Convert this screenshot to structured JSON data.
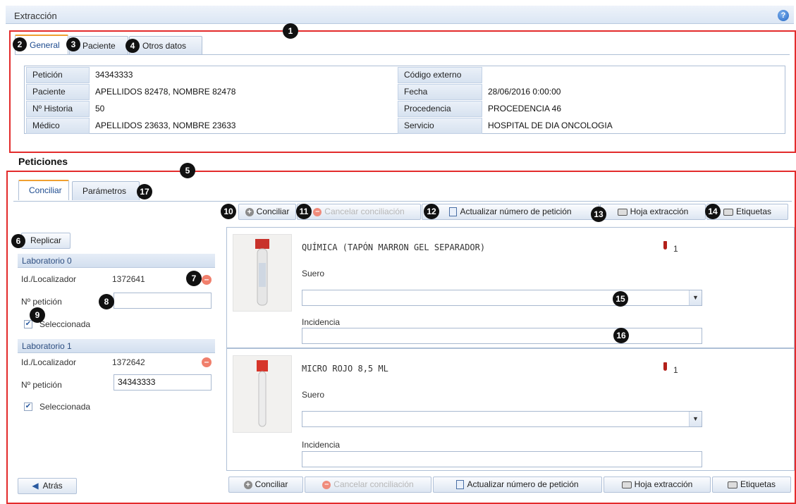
{
  "window": {
    "title": "Extracción",
    "help_icon": "?"
  },
  "badges": [
    "1",
    "2",
    "3",
    "4",
    "5",
    "6",
    "7",
    "8",
    "9",
    "10",
    "11",
    "12",
    "13",
    "14",
    "15",
    "16",
    "17"
  ],
  "colors": {
    "highlight": "#e32b2b",
    "accent": "#f0a030",
    "header_bg": "#dbe6f4"
  },
  "header_tabs": [
    {
      "label": "General",
      "active": true
    },
    {
      "label": "Paciente",
      "active": false
    },
    {
      "label": "Otros datos",
      "active": false
    }
  ],
  "general": {
    "left": [
      {
        "label": "Petición",
        "value": "34343333"
      },
      {
        "label": "Paciente",
        "value": "APELLIDOS 82478, NOMBRE 82478"
      },
      {
        "label": "Nº Historia",
        "value": "50"
      },
      {
        "label": "Médico",
        "value": "APELLIDOS 23633, NOMBRE 23633"
      }
    ],
    "right": [
      {
        "label": "Código externo",
        "value": ""
      },
      {
        "label": "Fecha",
        "value": "28/06/2016 0:00:00"
      },
      {
        "label": "Procedencia",
        "value": "PROCEDENCIA 46"
      },
      {
        "label": "Servicio",
        "value": "HOSPITAL DE DIA ONCOLOGIA"
      }
    ]
  },
  "peticiones": {
    "title": "Peticiones",
    "tabs": [
      {
        "label": "Conciliar",
        "active": true
      },
      {
        "label": "Parámetros",
        "active": false
      }
    ],
    "toolbar": {
      "conciliar": "Conciliar",
      "cancelar": "Cancelar conciliación",
      "actualizar": "Actualizar número de petición",
      "hoja": "Hoja extracción",
      "etiquetas": "Etiquetas"
    },
    "replicar": "Replicar",
    "atras": "Atrás",
    "labs": [
      {
        "header": "Laboratorio 0",
        "id_label": "Id./Localizador",
        "id_value": "1372641",
        "num_label": "Nº petición",
        "num_value": "",
        "selected_label": "Seleccionada",
        "selected": true
      },
      {
        "header": "Laboratorio 1",
        "id_label": "Id./Localizador",
        "id_value": "1372642",
        "num_label": "Nº petición",
        "num_value": "34343333",
        "selected_label": "Seleccionada",
        "selected": true
      }
    ],
    "tubes": [
      {
        "name": "QUÍMICA (TAPÓN MARRON GEL SEPARADOR)",
        "count": "1",
        "suero_label": "Suero",
        "incidencia_label": "Incidencia",
        "suero_value": "",
        "incidencia_value": ""
      },
      {
        "name": "MICRO ROJO 8,5 ML",
        "count": "1",
        "suero_label": "Suero",
        "incidencia_label": "Incidencia",
        "suero_value": "",
        "incidencia_value": ""
      }
    ]
  }
}
